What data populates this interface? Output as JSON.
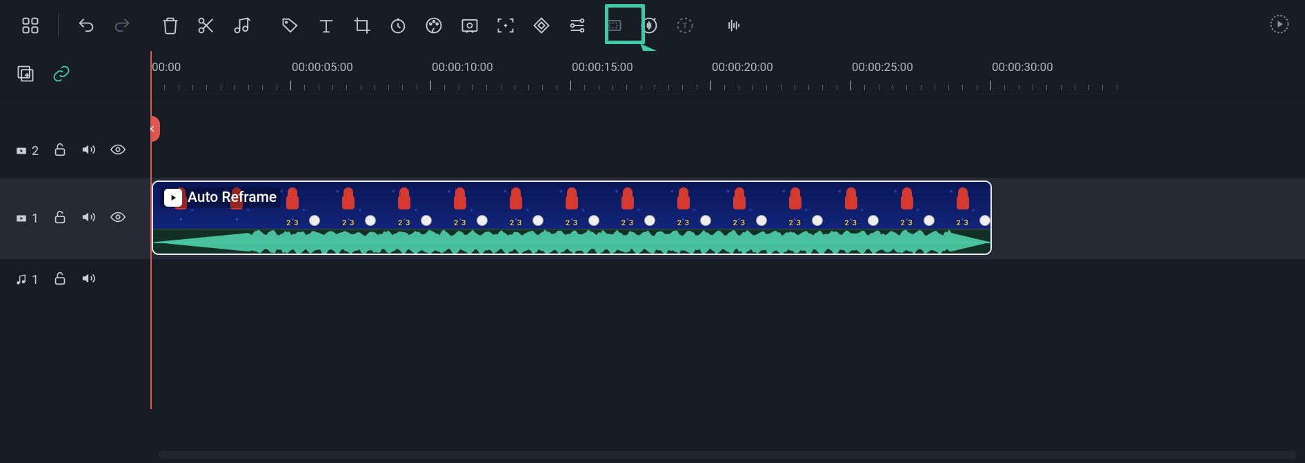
{
  "toolbar": {
    "highlight_target": "audio-stretch"
  },
  "ruler": {
    "labels": [
      "00:00",
      "00:00:05:00",
      "00:00:10:00",
      "00:00:15:00",
      "00:00:20:00",
      "00:00:25:00",
      "00:00:30:00"
    ]
  },
  "tracks": {
    "video2": {
      "label": "2"
    },
    "video1": {
      "label": "1"
    },
    "audio1": {
      "label": "1"
    }
  },
  "clip": {
    "title": "Auto Reframe",
    "year_text": "2 3"
  }
}
